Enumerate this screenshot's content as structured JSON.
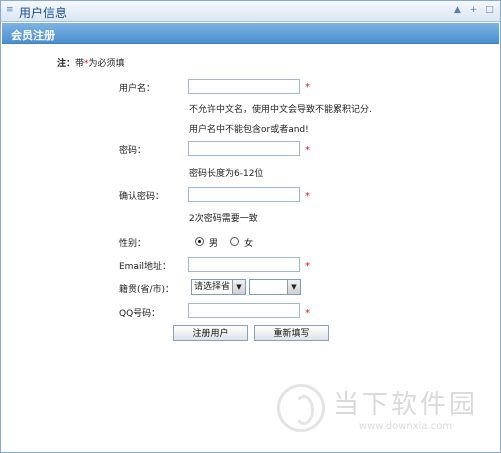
{
  "window": {
    "title": "用户信息",
    "grip_icon": "≡",
    "controls": [
      "▲",
      "+",
      "□"
    ]
  },
  "section": {
    "title": "会员注册"
  },
  "note": {
    "prefix": "注：",
    "before": "带",
    "star": "*",
    "after": "为必须填"
  },
  "form": {
    "username_label": "用户名：",
    "username_value": "",
    "username_hint1": "不允许中文名，使用中文会导致不能累积记分.",
    "username_hint2": "用户名中不能包含or或者and!",
    "password_label": "密码：",
    "password_value": "",
    "password_hint": "密码长度为6-12位",
    "confirm_label": "确认密码：",
    "confirm_value": "",
    "confirm_hint": "2次密码需要一致",
    "gender_label": "性别：",
    "gender_male": "男",
    "gender_female": "女",
    "gender_selected": "男",
    "email_label": "Email地址：",
    "email_value": "",
    "region_label": "籍贯(省/市)：",
    "province_selected": "请选择省",
    "city_selected": "",
    "qq_label": "QQ号码：",
    "qq_value": "",
    "required_star": "*",
    "submit_label": "注册用户",
    "reset_label": "重新填写"
  },
  "watermark": {
    "line1": "当下软件园",
    "line2": "www.downxia.com"
  }
}
